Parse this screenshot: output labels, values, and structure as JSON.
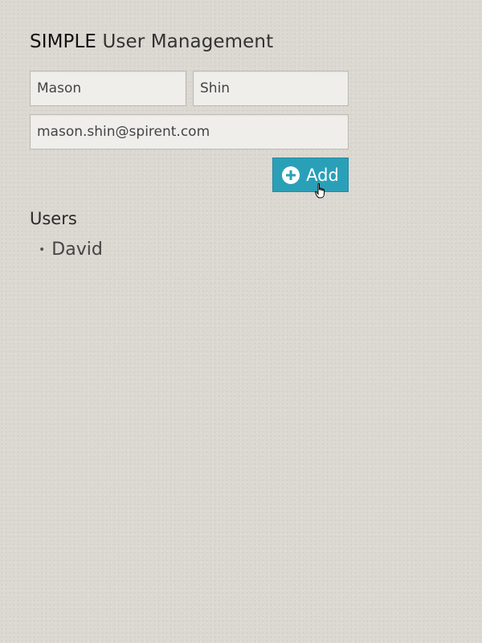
{
  "header": {
    "brand": "SIMPLE",
    "title": "User Management"
  },
  "form": {
    "first_name_value": "Mason",
    "last_name_value": "Shin",
    "email_value": "mason.shin@spirent.com",
    "add_label": "Add",
    "add_icon": "plus-circle-icon"
  },
  "users": {
    "heading": "Users",
    "items": [
      {
        "name": "David"
      }
    ]
  },
  "colors": {
    "accent": "#2aa0b8",
    "background": "#dcd8d2",
    "field_background": "#efeeeb"
  },
  "cursor": {
    "icon": "hand-pointer-icon"
  }
}
